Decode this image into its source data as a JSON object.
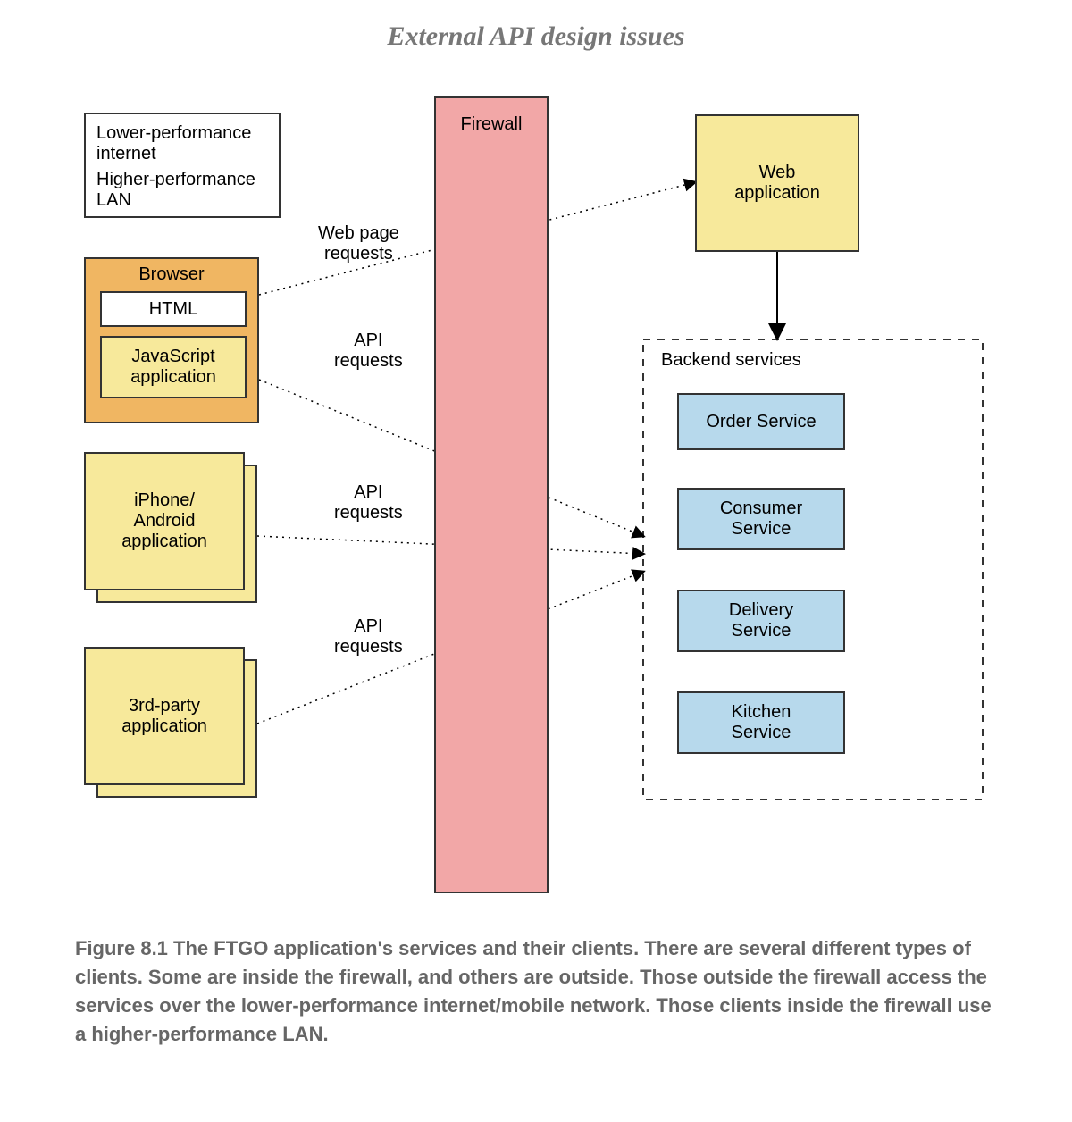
{
  "page_title": "External API design issues",
  "legend": {
    "row1": "Lower-performance\ninternet",
    "row2": "Higher-performance\nLAN"
  },
  "browser": {
    "title": "Browser",
    "html": "HTML",
    "js": "JavaScript\napplication"
  },
  "mobile": "iPhone/\nAndroid\napplication",
  "thirdparty": "3rd-party\napplication",
  "firewall": "Firewall",
  "webapp": "Web\napplication",
  "backend_header": "Backend services",
  "services": {
    "order": "Order Service",
    "consumer": "Consumer\nService",
    "delivery": "Delivery\nService",
    "kitchen": "Kitchen\nService"
  },
  "labels": {
    "web_page_requests": "Web page\nrequests",
    "api_requests": "API\nrequests"
  },
  "caption": {
    "num": "Figure 8.1",
    "text": "   The FTGO application's services and their clients. There are several different types of clients. Some are inside the firewall, and others are outside. Those outside the firewall access the services over the lower-performance internet/mobile network. Those clients inside the firewall use a higher-performance LAN."
  }
}
